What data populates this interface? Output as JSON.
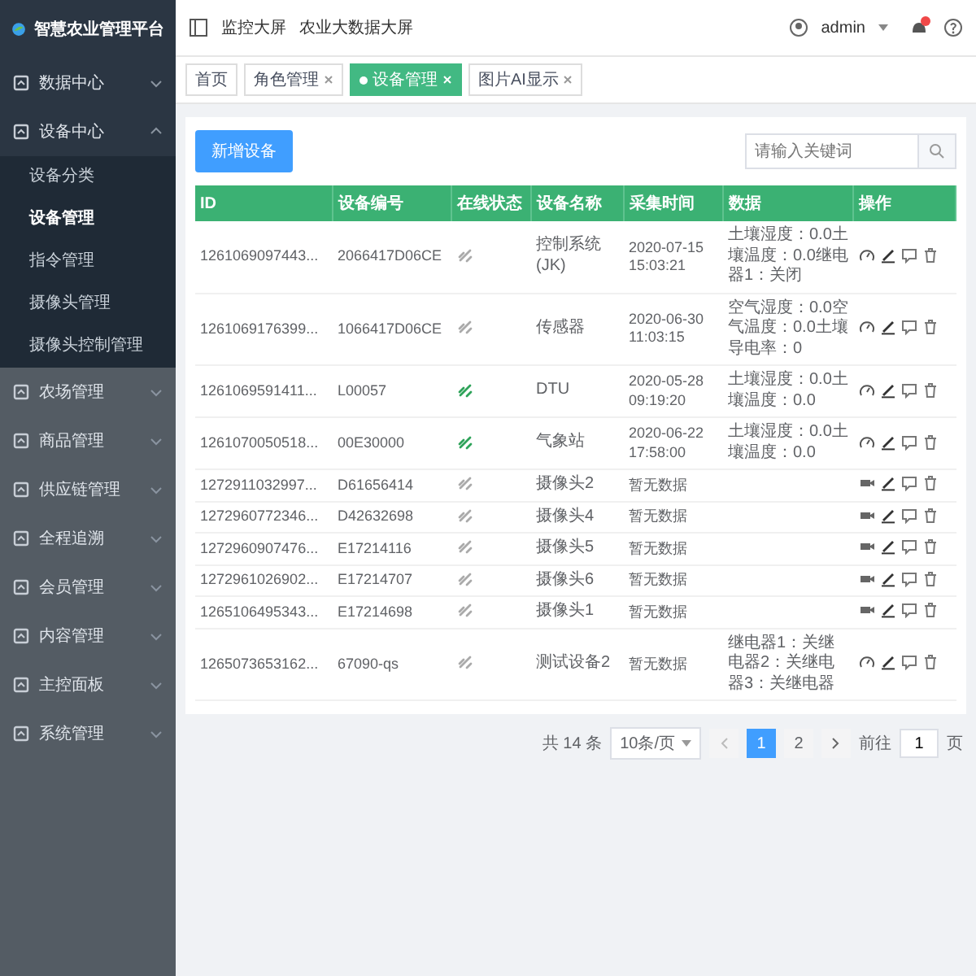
{
  "sidebar": {
    "logo": "智慧农业管理平台",
    "items": [
      {
        "label": "数据中心",
        "expanded": false
      },
      {
        "label": "设备中心",
        "expanded": true,
        "children": [
          {
            "label": "设备分类",
            "selected": false
          },
          {
            "label": "设备管理",
            "selected": true
          },
          {
            "label": "指令管理",
            "selected": false
          },
          {
            "label": "摄像头管理",
            "selected": false
          },
          {
            "label": "摄像头控制管理",
            "selected": false
          }
        ]
      },
      {
        "label": "农场管理",
        "expanded": false
      },
      {
        "label": "商品管理",
        "expanded": false
      },
      {
        "label": "供应链管理",
        "expanded": false
      },
      {
        "label": "全程追溯",
        "expanded": false
      },
      {
        "label": "会员管理",
        "expanded": false
      },
      {
        "label": "内容管理",
        "expanded": false
      },
      {
        "label": "主控面板",
        "expanded": false
      },
      {
        "label": "系统管理",
        "expanded": false
      }
    ]
  },
  "topbar": {
    "links": [
      "监控大屏",
      "农业大数据大屏"
    ],
    "user": "admin"
  },
  "tags": [
    {
      "label": "首页",
      "selected": false,
      "closable": false
    },
    {
      "label": "角色管理",
      "selected": false,
      "closable": true
    },
    {
      "label": "设备管理",
      "selected": true,
      "closable": true
    },
    {
      "label": "图片AI显示",
      "selected": false,
      "closable": true
    }
  ],
  "add_button": "新增设备",
  "search": {
    "placeholder": "请输入关键词"
  },
  "table": {
    "columns": [
      "ID",
      "设备编号",
      "在线状态",
      "设备名称",
      "采集时间",
      "数据",
      "操作"
    ],
    "rows": [
      {
        "id": "1261069097443...",
        "code": "2066417D06CE",
        "online": false,
        "name": "控制系统(JK)",
        "time": "2020-07-15 15:03:21",
        "data": "土壤湿度：0.0土壤温度：0.0继电器1：关闭",
        "kind": "gauge"
      },
      {
        "id": "1261069176399...",
        "code": "1066417D06CE",
        "online": false,
        "name": "传感器",
        "time": "2020-06-30 11:03:15",
        "data": "空气湿度：0.0空气温度：0.0土壤导电率：0",
        "kind": "gauge"
      },
      {
        "id": "1261069591411...",
        "code": "L00057",
        "online": true,
        "name": "DTU",
        "time": "2020-05-28 09:19:20",
        "data": "土壤湿度：0.0土壤温度：0.0",
        "kind": "gauge"
      },
      {
        "id": "1261070050518...",
        "code": "00E30000",
        "online": true,
        "name": "气象站",
        "time": "2020-06-22 17:58:00",
        "data": "土壤湿度：0.0土壤温度：0.0",
        "kind": "gauge"
      },
      {
        "id": "1272911032997...",
        "code": "D61656414",
        "online": false,
        "name": "摄像头2",
        "time": "暂无数据",
        "kind": "camera"
      },
      {
        "id": "1272960772346...",
        "code": "D42632698",
        "online": false,
        "name": "摄像头4",
        "time": "暂无数据",
        "kind": "camera"
      },
      {
        "id": "1272960907476...",
        "code": "E17214116",
        "online": false,
        "name": "摄像头5",
        "time": "暂无数据",
        "kind": "camera"
      },
      {
        "id": "1272961026902...",
        "code": "E17214707",
        "online": false,
        "name": "摄像头6",
        "time": "暂无数据",
        "kind": "camera"
      },
      {
        "id": "1265106495343...",
        "code": "E17214698",
        "online": false,
        "name": "摄像头1",
        "time": "暂无数据",
        "kind": "camera"
      },
      {
        "id": "1265073653162...",
        "code": "67090-qs",
        "online": false,
        "name": "测试设备2",
        "time": "暂无数据",
        "data": "继电器1：关继电器2：关继电器3：关继电器",
        "kind": "gauge"
      }
    ]
  },
  "pagination": {
    "total": "共 14 条",
    "page_size": "10条/页",
    "pages": [
      {
        "label": "1",
        "selected": true
      },
      {
        "label": "2",
        "selected": false
      }
    ],
    "goto": "前往",
    "goto_value": "1",
    "goto_unit": "页"
  }
}
